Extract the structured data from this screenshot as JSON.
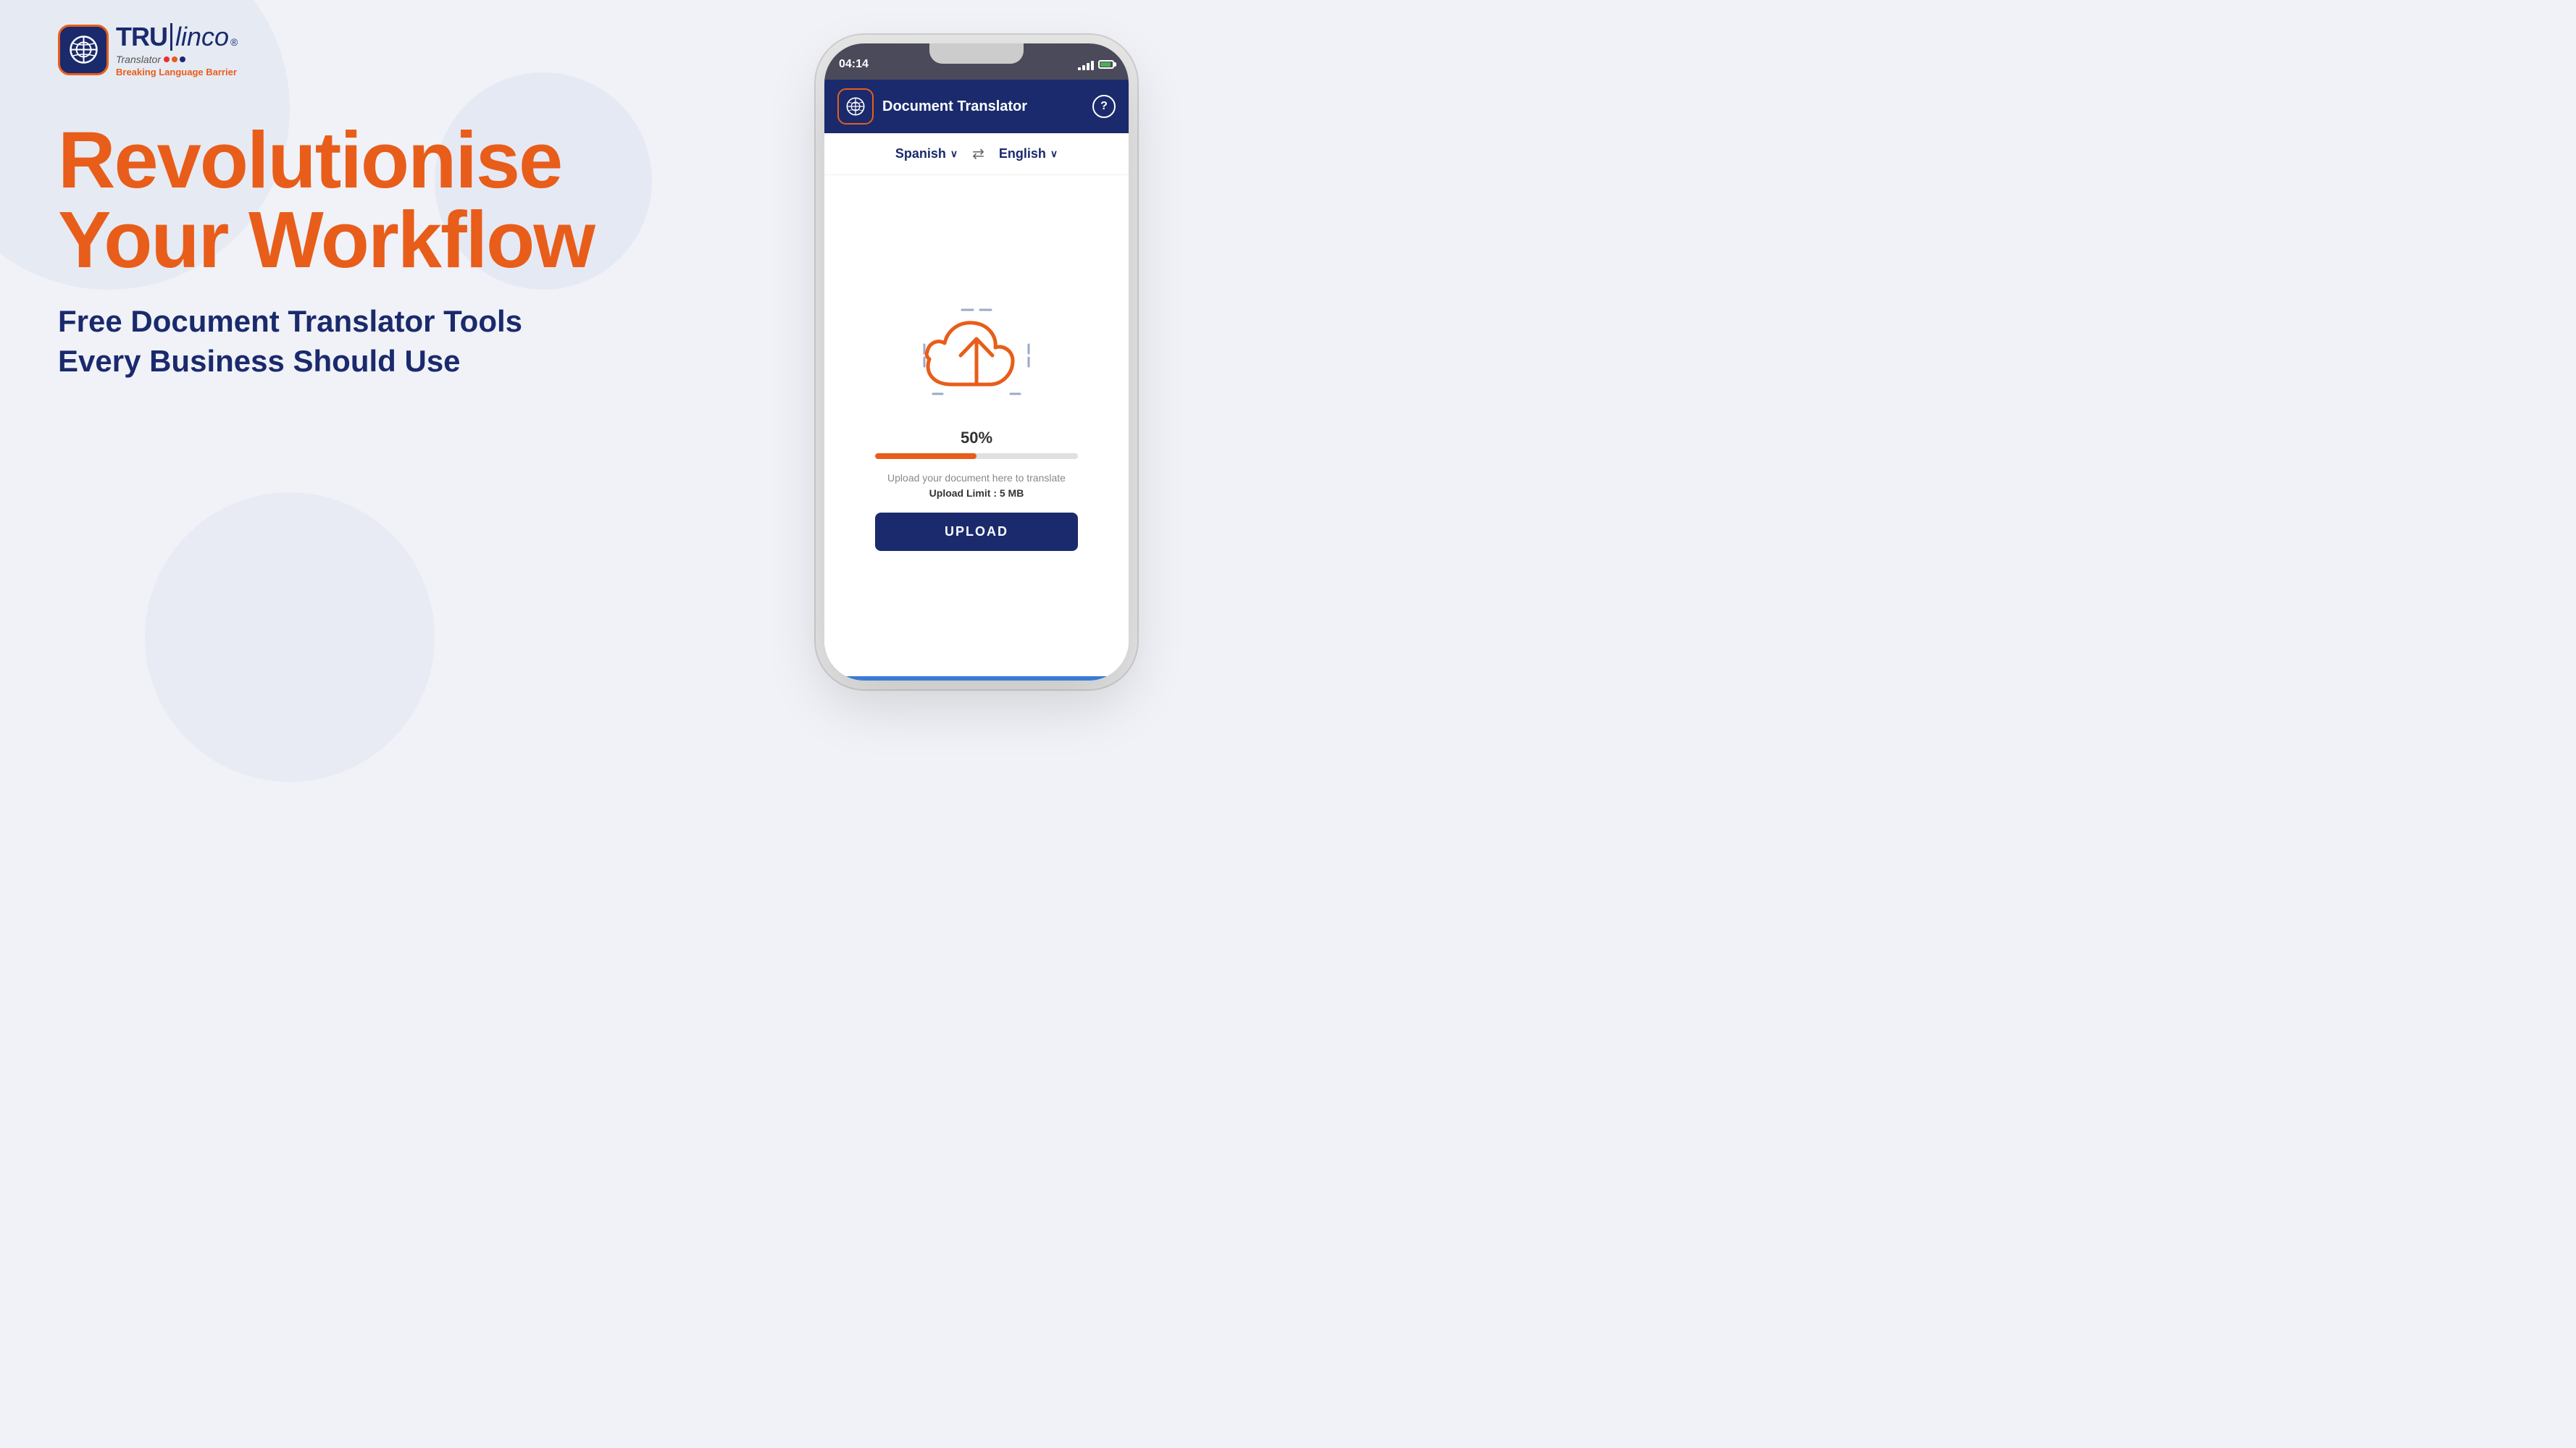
{
  "background": {
    "color": "#f0f2f7"
  },
  "logo": {
    "tru": "TRU",
    "linco": "linco",
    "registered": "®",
    "translator": "Translator",
    "tagline": "Breaking Language Barrier",
    "icon_alt": "TRUlinco logo icon"
  },
  "hero": {
    "heading_line1": "Revolutionise",
    "heading_line2": "Your Workflow",
    "subheading_line1": "Free Document Translator Tools",
    "subheading_line2": "Every Business Should Use"
  },
  "phone": {
    "status_bar": {
      "time": "04:14",
      "signal_alt": "signal bars",
      "battery_alt": "battery"
    },
    "app_header": {
      "title": "Document Translator",
      "help": "?",
      "icon_alt": "app icon"
    },
    "language_row": {
      "source_lang": "Spanish",
      "target_lang": "English",
      "chevron": "∨",
      "swap": "⇄"
    },
    "upload_area": {
      "progress_percent": "50%",
      "description": "Upload your document here to translate",
      "limit_label": "Upload Limit : 5 MB",
      "button_label": "UPLOAD",
      "cloud_icon_alt": "cloud upload icon"
    }
  },
  "colors": {
    "orange": "#e85d1a",
    "navy": "#1a2a6c",
    "light_bg": "#f0f2f7",
    "progress_fill": "#e85d1a"
  }
}
